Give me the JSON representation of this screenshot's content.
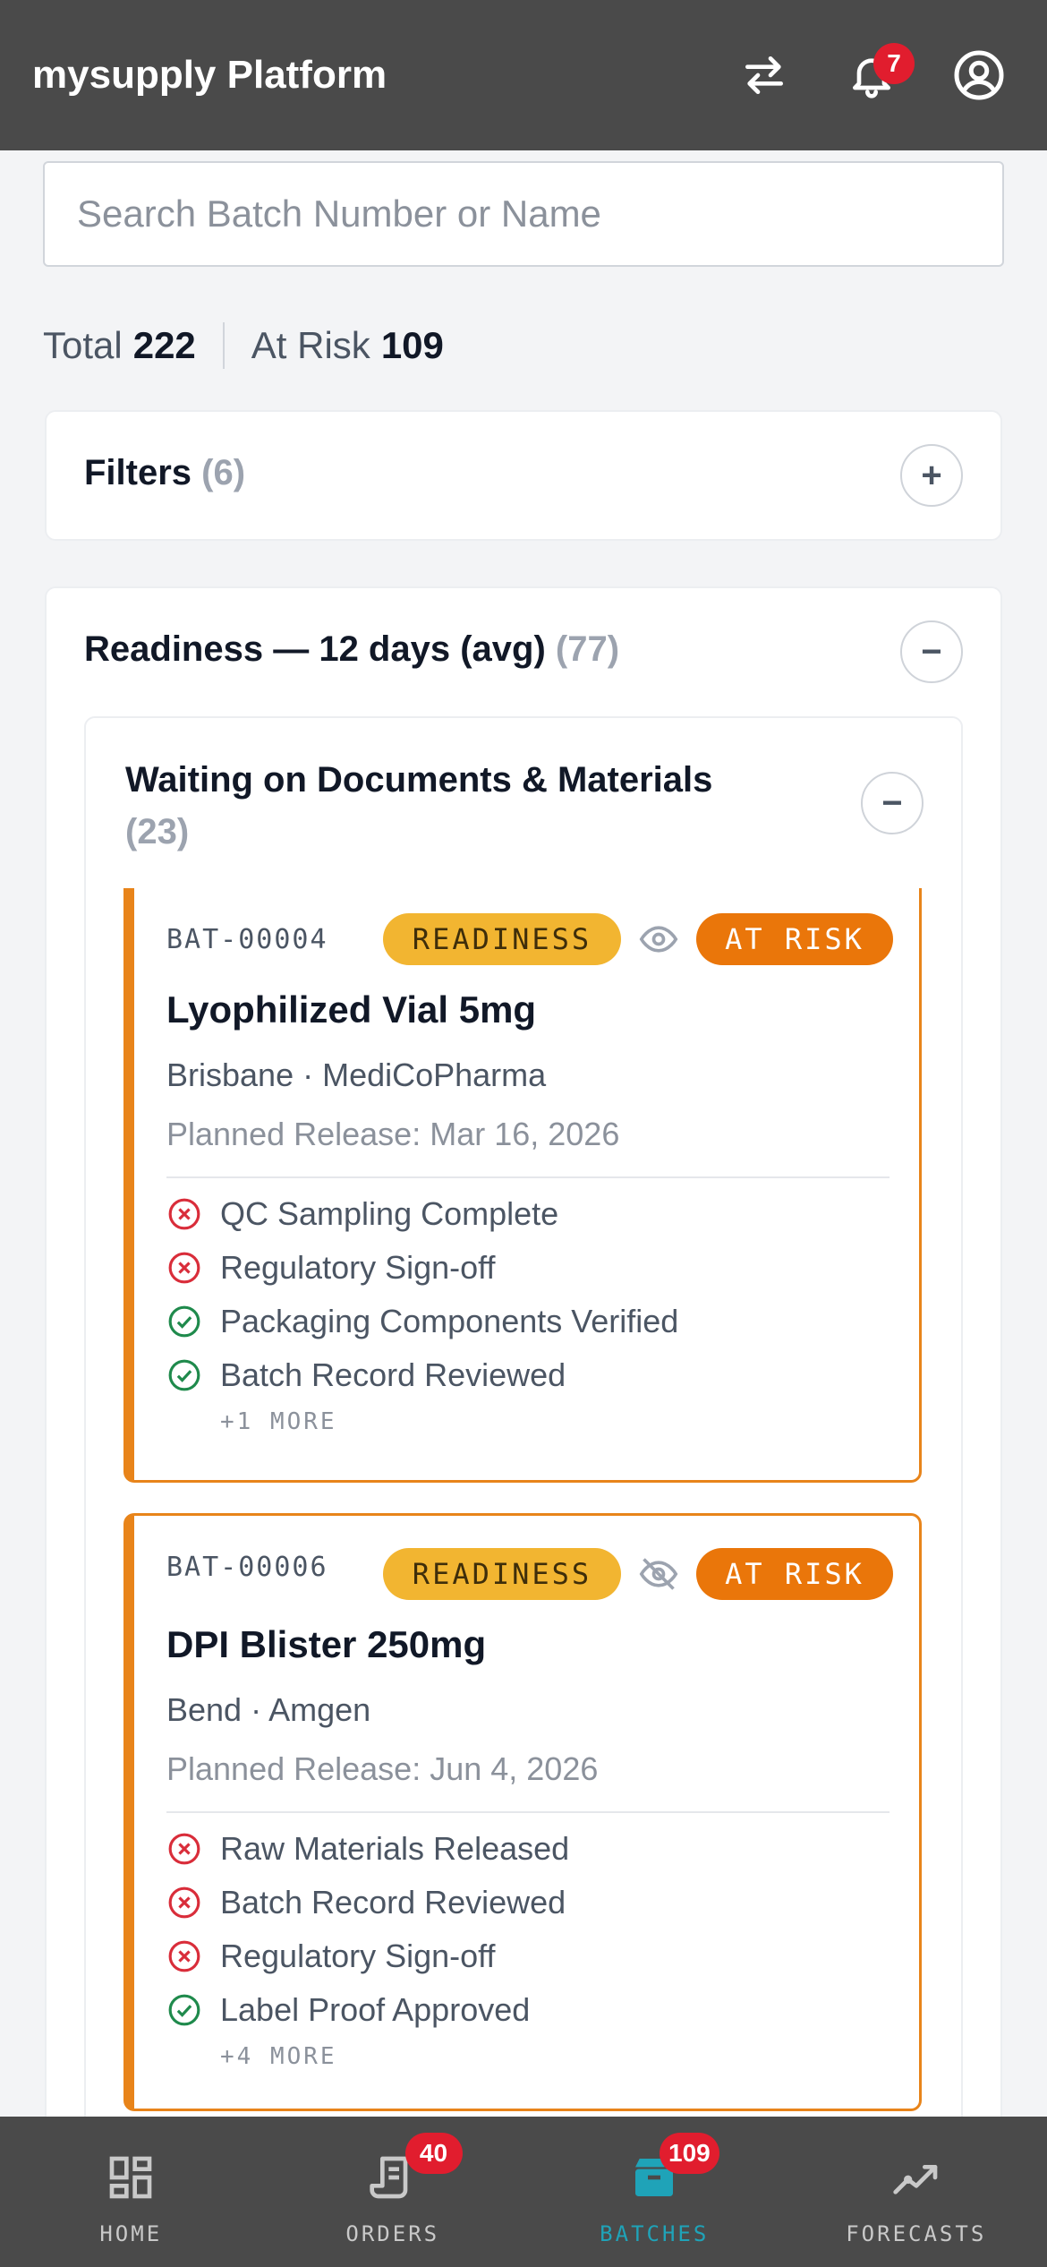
{
  "header": {
    "title": "mysupply Platform",
    "notification_count": "7",
    "icons": [
      "swap-icon",
      "bell-icon",
      "account-icon"
    ]
  },
  "search": {
    "placeholder": "Search Batch Number or Name",
    "value": ""
  },
  "totals": {
    "total_label": "Total",
    "total_value": "222",
    "risk_label": "At Risk",
    "risk_value": "109"
  },
  "filters": {
    "label": "Filters",
    "count": "(6)",
    "toggle": "+"
  },
  "readiness": {
    "label": "Readiness — 12 days (avg)",
    "count": "(77)",
    "toggle": "−",
    "group": {
      "label": "Waiting on Documents & Materials",
      "count": "(23)",
      "toggle": "−",
      "cards": [
        {
          "id": "BAT-00004",
          "phase": "READINESS",
          "status": "AT RISK",
          "watch_icon": "eye-icon",
          "name": "Lyophilized Vial 5mg",
          "location": "Brisbane · MediCoPharma",
          "release": "Planned Release: Mar 16, 2026",
          "checks": [
            {
              "label": "QC Sampling Complete",
              "ok": false
            },
            {
              "label": "Regulatory Sign-off",
              "ok": false
            },
            {
              "label": "Packaging Components Verified",
              "ok": true
            },
            {
              "label": "Batch Record Reviewed",
              "ok": true
            }
          ],
          "more": "+1 MORE"
        },
        {
          "id": "BAT-00006",
          "phase": "READINESS",
          "status": "AT RISK",
          "watch_icon": "eye-off-icon",
          "name": "DPI Blister 250mg",
          "location": "Bend · Amgen",
          "release": "Planned Release: Jun 4, 2026",
          "checks": [
            {
              "label": "Raw Materials Released",
              "ok": false
            },
            {
              "label": "Batch Record Reviewed",
              "ok": false
            },
            {
              "label": "Regulatory Sign-off",
              "ok": false
            },
            {
              "label": "Label Proof Approved",
              "ok": true
            }
          ],
          "more": "+4 MORE"
        }
      ]
    }
  },
  "tabs": [
    {
      "label": "HOME",
      "badge": "",
      "icon": "dashboard-icon"
    },
    {
      "label": "ORDERS",
      "badge": "40",
      "icon": "receipt-icon"
    },
    {
      "label": "BATCHES",
      "badge": "109",
      "icon": "box-icon",
      "active": true
    },
    {
      "label": "FORECASTS",
      "badge": "",
      "icon": "trend-icon"
    }
  ],
  "colors": {
    "at_risk": "#ea760a",
    "readiness": "#f2b531",
    "fail": "#d92d3a",
    "pass": "#1f8a4c",
    "active_tab": "#1fa3b8"
  }
}
